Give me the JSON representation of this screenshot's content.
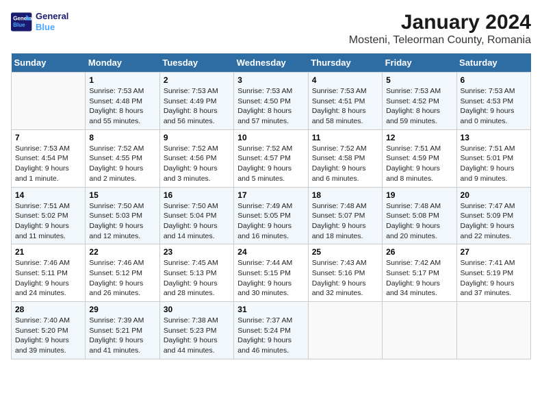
{
  "header": {
    "logo_line1": "General",
    "logo_line2": "Blue",
    "title": "January 2024",
    "subtitle": "Mosteni, Teleorman County, Romania"
  },
  "weekdays": [
    "Sunday",
    "Monday",
    "Tuesday",
    "Wednesday",
    "Thursday",
    "Friday",
    "Saturday"
  ],
  "weeks": [
    [
      {
        "day": "",
        "info": ""
      },
      {
        "day": "1",
        "info": "Sunrise: 7:53 AM\nSunset: 4:48 PM\nDaylight: 8 hours\nand 55 minutes."
      },
      {
        "day": "2",
        "info": "Sunrise: 7:53 AM\nSunset: 4:49 PM\nDaylight: 8 hours\nand 56 minutes."
      },
      {
        "day": "3",
        "info": "Sunrise: 7:53 AM\nSunset: 4:50 PM\nDaylight: 8 hours\nand 57 minutes."
      },
      {
        "day": "4",
        "info": "Sunrise: 7:53 AM\nSunset: 4:51 PM\nDaylight: 8 hours\nand 58 minutes."
      },
      {
        "day": "5",
        "info": "Sunrise: 7:53 AM\nSunset: 4:52 PM\nDaylight: 8 hours\nand 59 minutes."
      },
      {
        "day": "6",
        "info": "Sunrise: 7:53 AM\nSunset: 4:53 PM\nDaylight: 9 hours\nand 0 minutes."
      }
    ],
    [
      {
        "day": "7",
        "info": "Sunrise: 7:53 AM\nSunset: 4:54 PM\nDaylight: 9 hours\nand 1 minute."
      },
      {
        "day": "8",
        "info": "Sunrise: 7:52 AM\nSunset: 4:55 PM\nDaylight: 9 hours\nand 2 minutes."
      },
      {
        "day": "9",
        "info": "Sunrise: 7:52 AM\nSunset: 4:56 PM\nDaylight: 9 hours\nand 3 minutes."
      },
      {
        "day": "10",
        "info": "Sunrise: 7:52 AM\nSunset: 4:57 PM\nDaylight: 9 hours\nand 5 minutes."
      },
      {
        "day": "11",
        "info": "Sunrise: 7:52 AM\nSunset: 4:58 PM\nDaylight: 9 hours\nand 6 minutes."
      },
      {
        "day": "12",
        "info": "Sunrise: 7:51 AM\nSunset: 4:59 PM\nDaylight: 9 hours\nand 8 minutes."
      },
      {
        "day": "13",
        "info": "Sunrise: 7:51 AM\nSunset: 5:01 PM\nDaylight: 9 hours\nand 9 minutes."
      }
    ],
    [
      {
        "day": "14",
        "info": "Sunrise: 7:51 AM\nSunset: 5:02 PM\nDaylight: 9 hours\nand 11 minutes."
      },
      {
        "day": "15",
        "info": "Sunrise: 7:50 AM\nSunset: 5:03 PM\nDaylight: 9 hours\nand 12 minutes."
      },
      {
        "day": "16",
        "info": "Sunrise: 7:50 AM\nSunset: 5:04 PM\nDaylight: 9 hours\nand 14 minutes."
      },
      {
        "day": "17",
        "info": "Sunrise: 7:49 AM\nSunset: 5:05 PM\nDaylight: 9 hours\nand 16 minutes."
      },
      {
        "day": "18",
        "info": "Sunrise: 7:48 AM\nSunset: 5:07 PM\nDaylight: 9 hours\nand 18 minutes."
      },
      {
        "day": "19",
        "info": "Sunrise: 7:48 AM\nSunset: 5:08 PM\nDaylight: 9 hours\nand 20 minutes."
      },
      {
        "day": "20",
        "info": "Sunrise: 7:47 AM\nSunset: 5:09 PM\nDaylight: 9 hours\nand 22 minutes."
      }
    ],
    [
      {
        "day": "21",
        "info": "Sunrise: 7:46 AM\nSunset: 5:11 PM\nDaylight: 9 hours\nand 24 minutes."
      },
      {
        "day": "22",
        "info": "Sunrise: 7:46 AM\nSunset: 5:12 PM\nDaylight: 9 hours\nand 26 minutes."
      },
      {
        "day": "23",
        "info": "Sunrise: 7:45 AM\nSunset: 5:13 PM\nDaylight: 9 hours\nand 28 minutes."
      },
      {
        "day": "24",
        "info": "Sunrise: 7:44 AM\nSunset: 5:15 PM\nDaylight: 9 hours\nand 30 minutes."
      },
      {
        "day": "25",
        "info": "Sunrise: 7:43 AM\nSunset: 5:16 PM\nDaylight: 9 hours\nand 32 minutes."
      },
      {
        "day": "26",
        "info": "Sunrise: 7:42 AM\nSunset: 5:17 PM\nDaylight: 9 hours\nand 34 minutes."
      },
      {
        "day": "27",
        "info": "Sunrise: 7:41 AM\nSunset: 5:19 PM\nDaylight: 9 hours\nand 37 minutes."
      }
    ],
    [
      {
        "day": "28",
        "info": "Sunrise: 7:40 AM\nSunset: 5:20 PM\nDaylight: 9 hours\nand 39 minutes."
      },
      {
        "day": "29",
        "info": "Sunrise: 7:39 AM\nSunset: 5:21 PM\nDaylight: 9 hours\nand 41 minutes."
      },
      {
        "day": "30",
        "info": "Sunrise: 7:38 AM\nSunset: 5:23 PM\nDaylight: 9 hours\nand 44 minutes."
      },
      {
        "day": "31",
        "info": "Sunrise: 7:37 AM\nSunset: 5:24 PM\nDaylight: 9 hours\nand 46 minutes."
      },
      {
        "day": "",
        "info": ""
      },
      {
        "day": "",
        "info": ""
      },
      {
        "day": "",
        "info": ""
      }
    ]
  ]
}
